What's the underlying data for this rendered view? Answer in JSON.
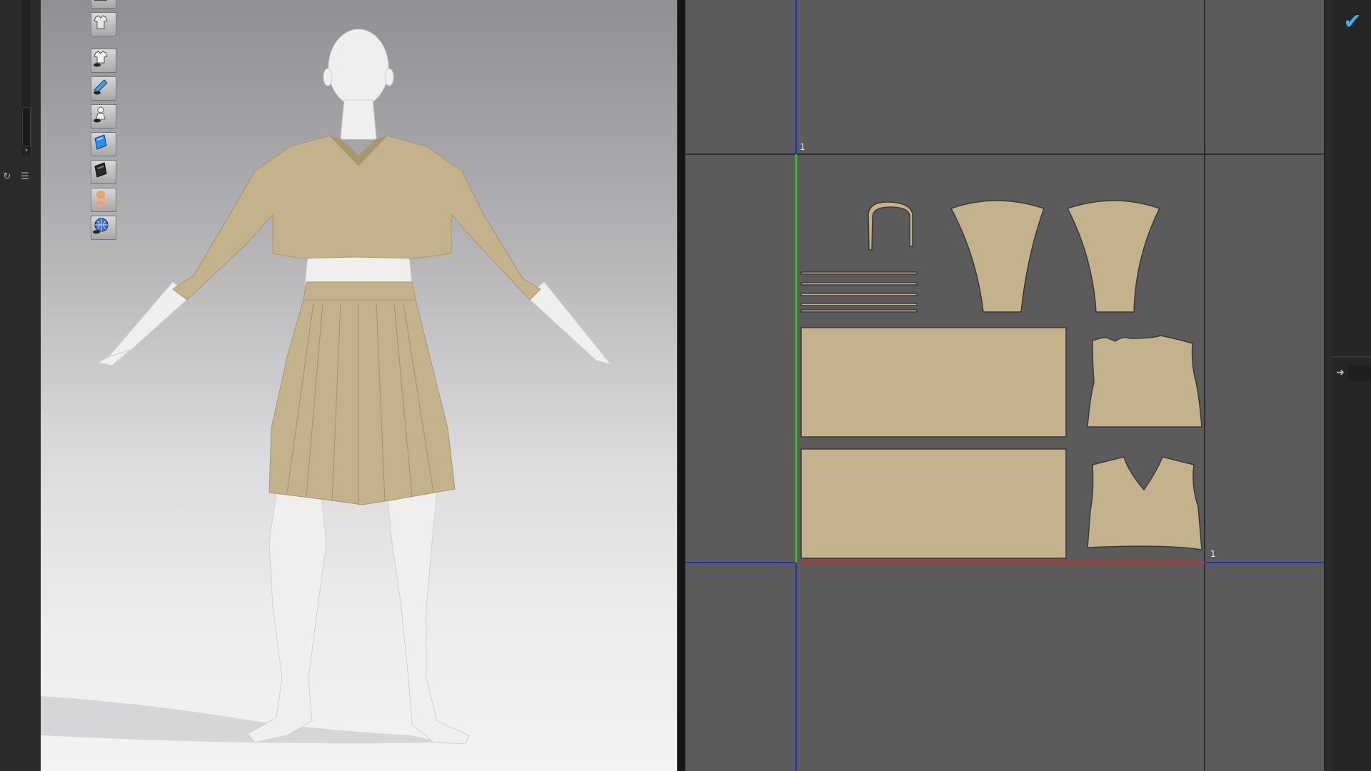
{
  "app": {
    "colors": {
      "fabric": "#c4b28c",
      "fabric_shadow": "#a8966e",
      "avatar": "#f0f0f0",
      "grid_bg": "#5b5b5b",
      "grid_line": "#1f1f1f",
      "axis_blue": "#1f2bd6",
      "axis_green": "#2ecc2e",
      "axis_red": "#d62b1f",
      "accent": "#3ab0ff"
    }
  },
  "left_strip": {
    "buttons": [
      {
        "name": "refresh-icon",
        "glyph": "↻"
      },
      {
        "name": "list-icon",
        "glyph": "☰"
      }
    ],
    "scroll_arrow": "▾"
  },
  "toolbar": {
    "tools": [
      {
        "name": "top-edge-tool-icon"
      },
      {
        "name": "garment-tool-icon"
      },
      {
        "name": "show-garment-icon"
      },
      {
        "name": "show-brush-icon"
      },
      {
        "name": "show-avatar-icon"
      },
      {
        "name": "texture-view-icon"
      },
      {
        "name": "shaded-view-icon"
      },
      {
        "name": "avatar-skin-icon"
      },
      {
        "name": "environment-icon"
      }
    ]
  },
  "pattern_window": {
    "grid_labels": [
      "1",
      "1"
    ]
  },
  "right_panel": {
    "check_glyph": "✔",
    "arrow_glyph": "➜"
  }
}
